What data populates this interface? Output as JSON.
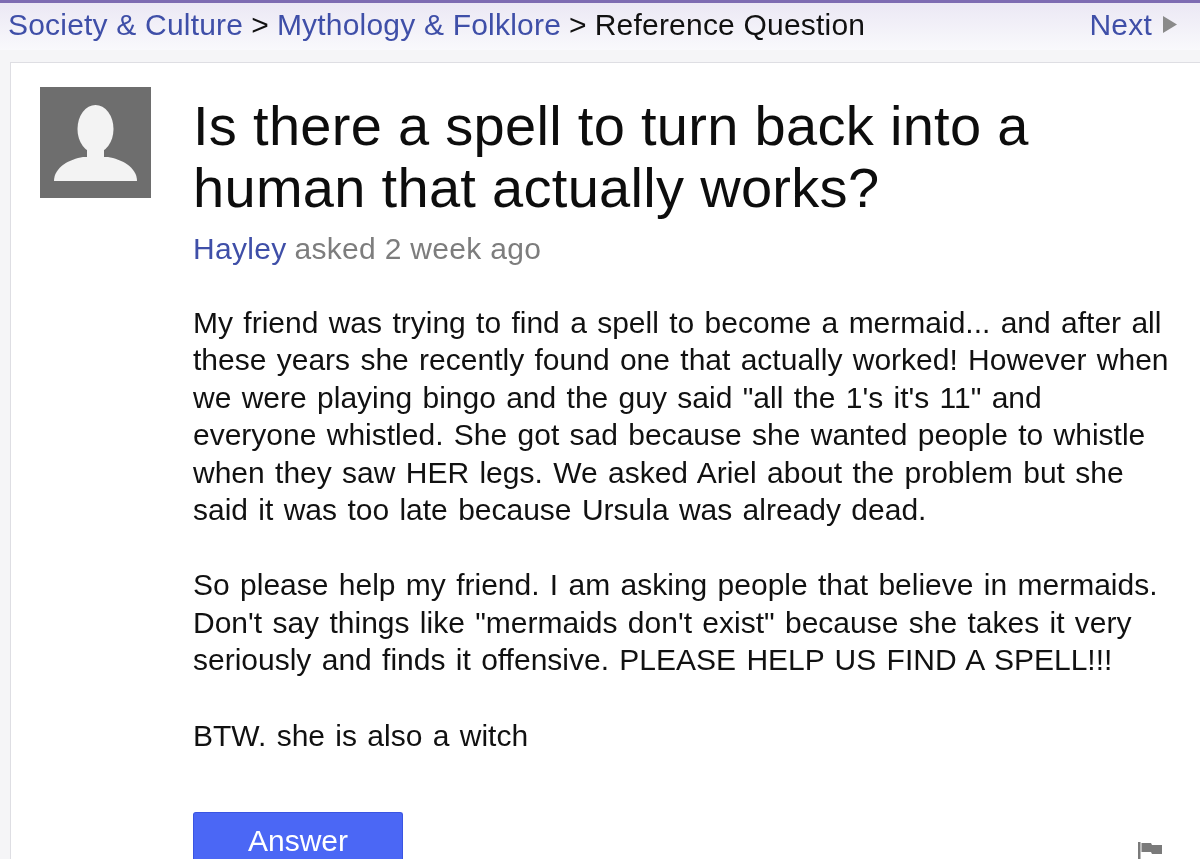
{
  "breadcrumb": {
    "items": [
      {
        "kind": "link",
        "label": "Society & Culture"
      },
      {
        "kind": "separator",
        "label": ">"
      },
      {
        "kind": "link",
        "label": "Mythology & Folklore"
      },
      {
        "kind": "separator",
        "label": ">"
      },
      {
        "kind": "current",
        "label": "Reference Question"
      }
    ]
  },
  "next_link": {
    "label": "Next"
  },
  "question": {
    "title": "Is there a spell to turn back into a human that actually works?",
    "author": "Hayley",
    "asked": "asked 2 week ago",
    "paragraphs": [
      "My friend was trying to find a spell to become a mermaid... and after all these years she recently found one that actually worked! However when we were playing bingo and the guy said \"all the 1's it's 11\" and everyone whistled. She got sad because she wanted people to whistle when they saw HER legs. We asked Ariel about the problem but she said it was too late because Ursula was already dead.",
      "So please help my friend. I am asking people that believe in mermaids. Don't say things like \"mermaids don't exist\" because she takes it very seriously and finds it offensive. PLEASE HELP US FIND A SPELL!!!",
      "BTW. she is also a witch"
    ]
  },
  "answer_button": {
    "label": "Answer"
  }
}
